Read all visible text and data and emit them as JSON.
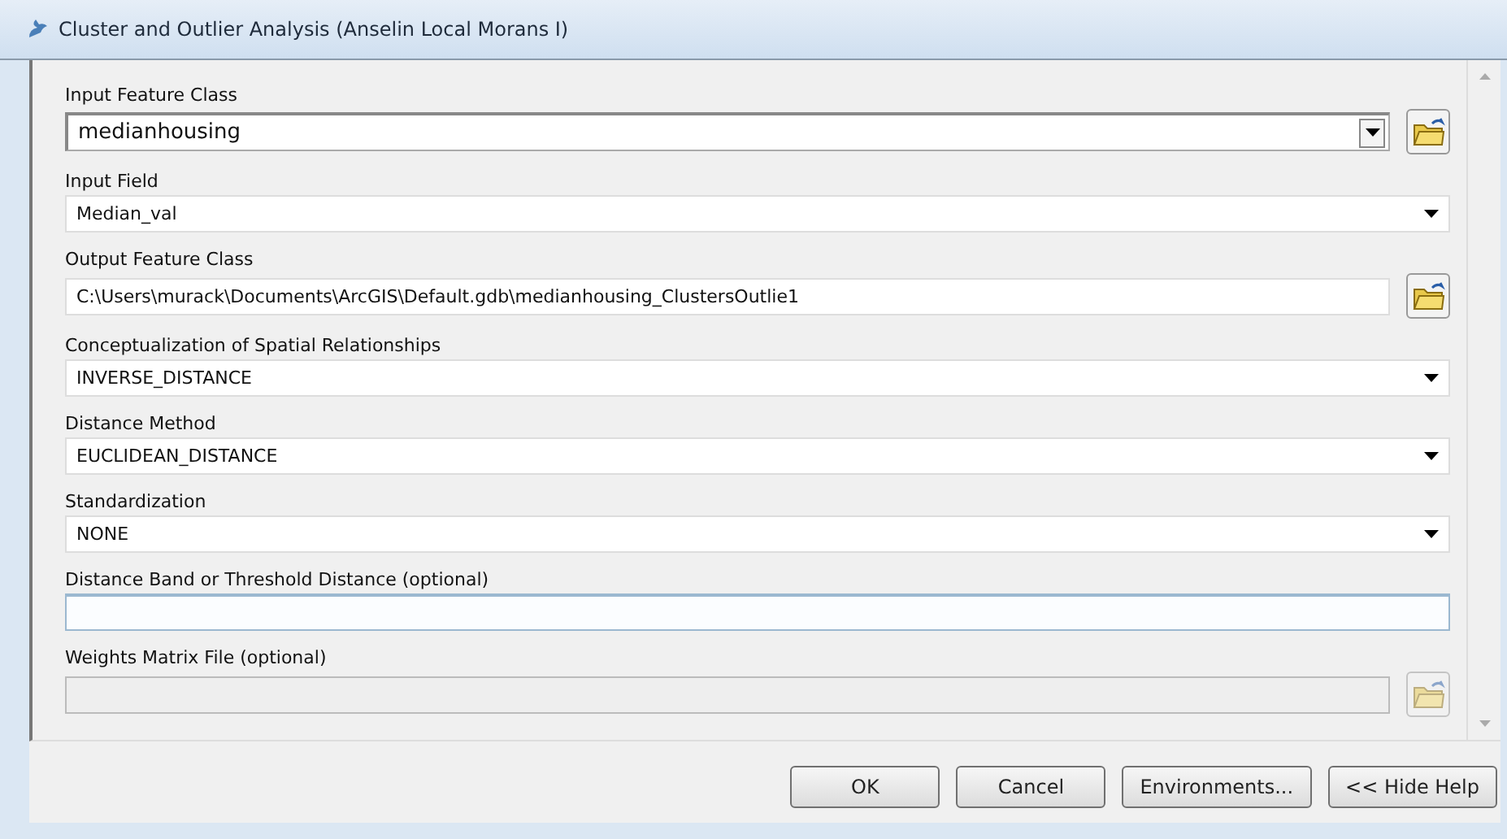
{
  "window": {
    "title": "Cluster and Outlier Analysis (Anselin Local Morans I)"
  },
  "parameters": [
    {
      "label": "Input Feature Class",
      "kind": "combo",
      "value": "medianhousing",
      "browse": true,
      "disabled": false,
      "focused": false
    },
    {
      "label": "Input Field",
      "kind": "dropdown",
      "value": "Median_val",
      "browse": false,
      "disabled": false,
      "focused": false
    },
    {
      "label": "Output Feature Class",
      "kind": "text",
      "value": "C:\\Users\\murack\\Documents\\ArcGIS\\Default.gdb\\medianhousing_ClustersOutlie1",
      "browse": true,
      "disabled": false,
      "focused": false
    },
    {
      "label": "Conceptualization of Spatial Relationships",
      "kind": "dropdown",
      "value": "INVERSE_DISTANCE",
      "browse": false,
      "disabled": false,
      "focused": false
    },
    {
      "label": "Distance Method",
      "kind": "dropdown",
      "value": "EUCLIDEAN_DISTANCE",
      "browse": false,
      "disabled": false,
      "focused": false
    },
    {
      "label": "Standardization",
      "kind": "dropdown",
      "value": "NONE",
      "browse": false,
      "disabled": false,
      "focused": false
    },
    {
      "label": "Distance Band or Threshold Distance (optional)",
      "kind": "text",
      "browse": false,
      "disabled": false,
      "focused": true
    },
    {
      "label": "Weights Matrix File (optional)",
      "kind": "text",
      "browse": true,
      "disabled": true,
      "focused": false
    }
  ],
  "buttons": [
    "OK",
    "Cancel",
    "Environments...",
    "<< Hide Help"
  ]
}
